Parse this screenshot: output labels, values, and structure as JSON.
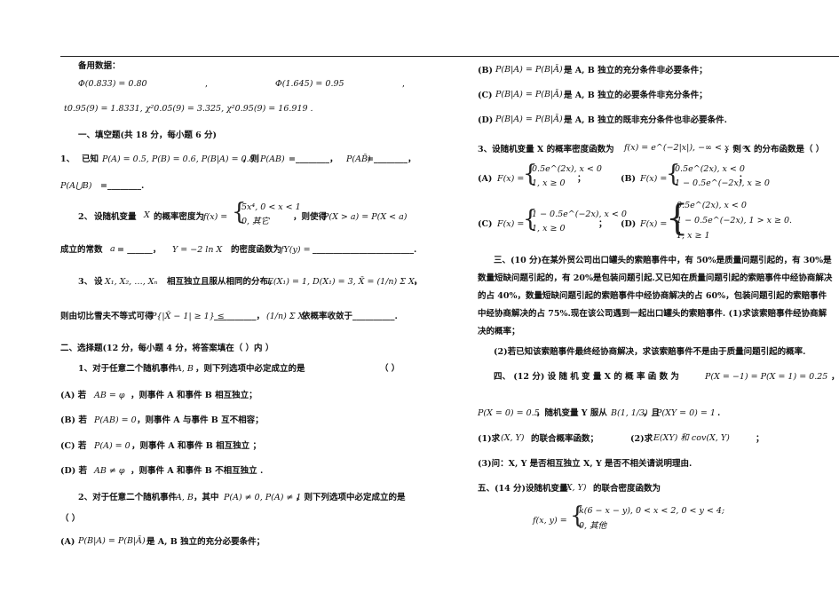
{
  "left": {
    "backup_title": "备用数据：",
    "phi1": "Φ(0.833) = 0.80",
    "phi1_comma": ",",
    "phi2": "Φ(1.645) = 0.95",
    "phi2_comma": ",",
    "quantiles": "t0.95(9) = 1.8331, χ²0.05(9) = 3.325, χ²0.95(9) = 16.919 .",
    "sec1_title": "一、填空题(共 18 分，每小题 6 分)",
    "q1_label": "1、",
    "q1_text_a": "已知",
    "q1_math_a": "P(A) = 0.5, P(B) = 0.6, P(B|A) = 0.8",
    "q1_text_b": "，则",
    "q1_math_b": "P(AB)",
    "q1_eq1": "=________，",
    "q1_math_c": "P(AB̄)",
    "q1_eq2": "=________，",
    "q1_math_d": "P(A⋃B)",
    "q1_eq3": "=________.",
    "q2_label": "2、",
    "q2_text_a": "设随机变量",
    "q2_math_x": "X",
    "q2_text_b": "的概率密度为",
    "q2_math_f": "f(x) =",
    "q2_case1": "5x⁴, 0 < x < 1",
    "q2_case2": "0, 其它",
    "q2_text_c": "，则使得",
    "q2_math_cond": "P(X > a) = P(X < a)",
    "q2_line2_a": "成立的常数",
    "q2_math_a": "a",
    "q2_line2_b": "= ______，",
    "q2_math_y": "Y = −2 ln X",
    "q2_line2_c": "的密度函数为",
    "q2_math_fy": "fY(y) =",
    "q2_line2_d": "________________________.",
    "q3_label": "3、",
    "q3_text_a": "设",
    "q3_math_a": "X₁, X₂, …, Xₙ",
    "q3_text_b": "相互独立且服从相同的分布，",
    "q3_math_b": "E(X₁) = 1, D(X₁) = 3, X̄ = (1/n) Σ Xᵢ",
    "q3_text_c": "，",
    "q3_line2_a": "则由切比雪夫不等式可得",
    "q3_math_c": "P{|X̄ − 1| ≥ 1} ≤",
    "q3_line2_b": "__________，",
    "q3_math_d": "(1/n) Σ Xᵢ²",
    "q3_line2_c": "依概率收敛于__________.",
    "sec2_title": "二、选择题(12 分，每小题 4 分，将答案填在（   ）内 ）",
    "c1_text": "1、对于任意二个随机事件",
    "c1_math": "A, B",
    "c1_text2": "，则下列选项中必定成立的是",
    "c1_paren": "（      ）",
    "c1_A": "(A)  若",
    "c1_A_math": "AB = φ",
    "c1_A_text": "，则事件 A 和事件 B 相互独立；",
    "c1_B": "(B)  若",
    "c1_B_math": "P(AB) = 0",
    "c1_B_text": "，则事件 A 与事件 B 互不相容；",
    "c1_C": "(C)  若",
    "c1_C_math": "P(A) = 0",
    "c1_C_text": "，则事件 A 和事件 B 相互独立 ；",
    "c1_D": "(D)  若",
    "c1_D_math": "AB ≠ φ",
    "c1_D_text": "，则事件 A 和事件 B 不相互独立 .",
    "c2_text": "2、对于任意二个随机事件",
    "c2_math": "A, B",
    "c2_text2": "，其中",
    "c2_math2": "P(A) ≠ 0, P(A) ≠ 1",
    "c2_text3": "，则下列选项中必定成立的是",
    "c2_paren": "（    ）",
    "c2_A": "(A)",
    "c2_A_math": "P(B|A) = P(B|Ā)",
    "c2_A_text": "是 A, B 独立的充分必要条件；"
  },
  "right": {
    "c2_B": "(B)",
    "c2_B_math": "P(B|A) = P(B|Ā)",
    "c2_B_text": "是 A, B 独立的充分条件非必要条件；",
    "c2_C": "(C)",
    "c2_C_math": "P(B|A) = P(B|Ā)",
    "c2_C_text": "是 A, B 独立的必要条件非充分条件；",
    "c2_D": "(D)",
    "c2_D_math": "P(B|A) = P(B|Ā)",
    "c2_D_text": "是 A, B 独立的既非充分条件也非必要条件.",
    "c3_text": "3、设随机变量 X 的概率密度函数为",
    "c3_math": "f(x) = e^(−2|x|), −∞ < x < ∞",
    "c3_text2": "，则 X 的分布函数是（   ）",
    "c3_A": "(A)",
    "c3_A_f": "F(x) =",
    "c3_A_1": "0.5e^(2x), x < 0",
    "c3_A_2": "1, x ≥ 0",
    "c3_A_end": "；",
    "c3_B": "(B)",
    "c3_B_f": "F(x) =",
    "c3_B_1": "0.5e^(2x), x < 0",
    "c3_B_2": "1 − 0.5e^(−2x), x ≥ 0",
    "c3_B_end": "；",
    "c3_C": "(C)",
    "c3_C_f": "F(x) =",
    "c3_C_1": "1 − 0.5e^(−2x), x < 0",
    "c3_C_2": "1, x ≥ 0",
    "c3_C_end": "；",
    "c3_D": "(D)",
    "c3_D_f": "F(x) =",
    "c3_D_1": "0.5e^(2x), x < 0",
    "c3_D_2": "1 − 0.5e^(−2x), 1 > x ≥ 0.",
    "c3_D_3": "1, x ≥ 1",
    "sec3_text": "三、(10 分)在某外贸公司出口罐头的索赔事件中，有 50%是质量问题引起的，有 30%是数量短缺问题引起的，有 20%是包装问题引起.又已知在质量问题引起的索赔事件中经协商解决的占 40%，数量短缺问题引起的索赔事件中经协商解决的占 60%，包装问题引起的索赔事件中经协商解决的占 75%.现在该公司遇到一起出口罐头的索赔事件.   (1)求该索赔事件经协商解决的概率；",
    "sec3_q2": "(2)若已知该索赔事件最终经协商解决，求该索赔事件不是由于质量问题引起的概率.",
    "sec4_a": "四、 (12 分) 设 随 机 变 量 X 的 概 率 函 数 为",
    "sec4_math1": "P(X = −1) = P(X = 1) = 0.25",
    "sec4_a_end": "，",
    "sec4_math2": "P(X = 0) = 0.5",
    "sec4_b": "，随机变量 Y 服从",
    "sec4_math3": "B(1, 1/3)",
    "sec4_b2": "，且",
    "sec4_math4": "P(XY = 0) = 1",
    "sec4_b_end": ".",
    "sec4_q1": "(1)求",
    "sec4_q1_math": "(X, Y)",
    "sec4_q1b": "的联合概率函数；",
    "sec4_q2": "(2)求",
    "sec4_q2_math": "E(XY) 和 cov(X, Y)",
    "sec4_q2b": "；",
    "sec4_q3": "(3)问：X, Y 是否相互独立 X, Y 是否不相关请说明理由.",
    "sec5_title": "五、(14 分)设随机变量",
    "sec5_math": "(X, Y)",
    "sec5_title2": "的联合密度函数为",
    "sec5_f": "f(x, y) =",
    "sec5_case1": "k(6 − x − y), 0 < x < 2,  0 < y < 4;",
    "sec5_case2": "0, 其他"
  }
}
